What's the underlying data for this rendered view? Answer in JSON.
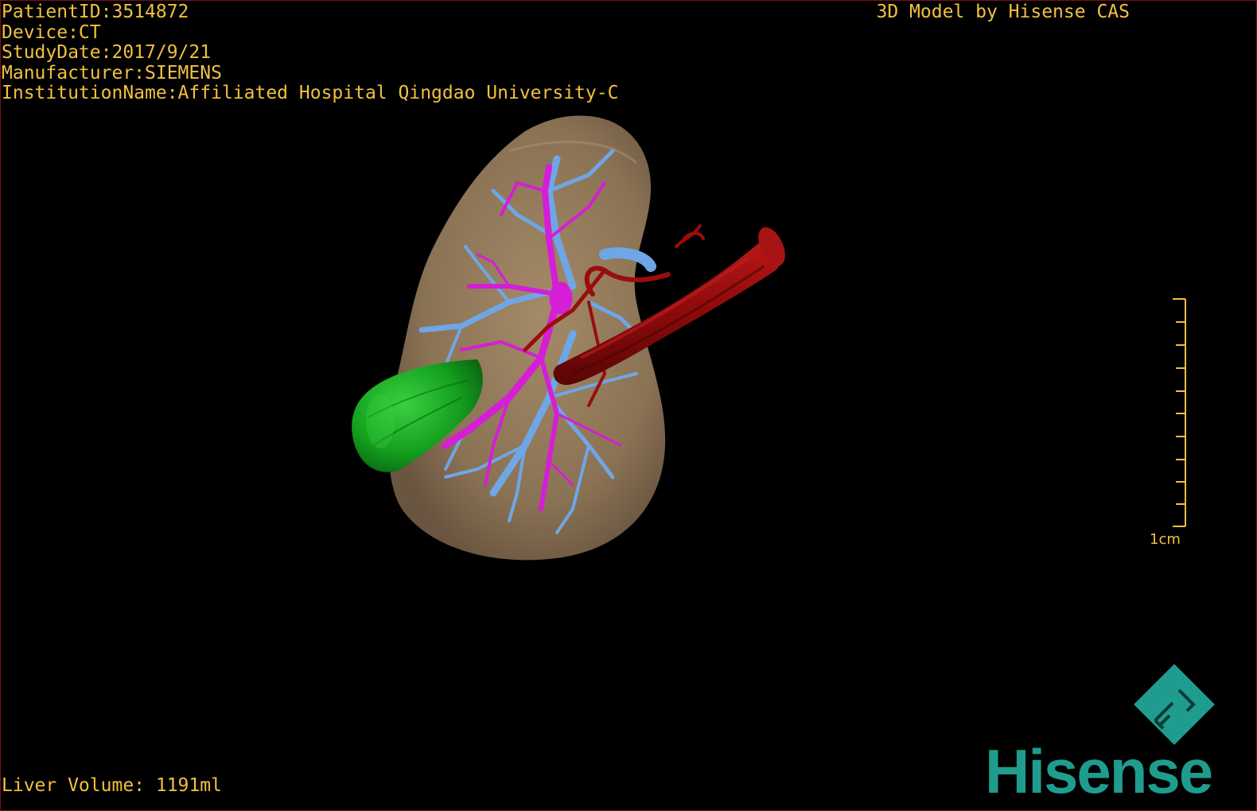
{
  "patient_info": {
    "patient_id": "PatientID:3514872",
    "device": "Device:CT",
    "study_date": "StudyDate:2017/9/21",
    "manufacturer": "Manufacturer:SIEMENS",
    "institution": "InstitutionName:Affiliated Hospital Qingdao University-C"
  },
  "brand_caption": "3D Model by Hisense CAS",
  "liver_volume": "Liver Volume: 1191ml",
  "scale": {
    "label": "1cm"
  },
  "logo": {
    "word": "Hisense",
    "mark_letters": "FL"
  },
  "colors": {
    "text": "#f0c040",
    "liver": "#8c7456",
    "portal_vein": "#6fa6e6",
    "hepatic_vein": "#d51ed6",
    "artery": "#9a0d0d",
    "tumor": "#15a520",
    "brand": "#1f9c8e"
  },
  "icons": [
    "3d-liver-model",
    "scale-bar",
    "hisense-logo"
  ]
}
